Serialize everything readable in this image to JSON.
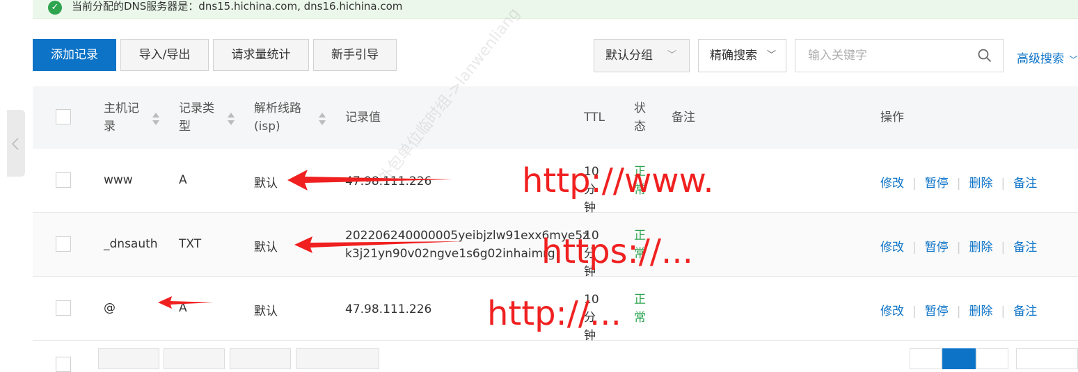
{
  "notice": {
    "text": "当前分配的DNS服务器是：dns15.hichina.com, dns16.hichina.com"
  },
  "toolbar": {
    "add_record": "添加记录",
    "import_export": "导入/导出",
    "request_stats": "请求量统计",
    "guide": "新手引导",
    "group_select": "默认分组",
    "search_mode": "精确搜索",
    "search_placeholder": "输入关键字",
    "advanced_search": "高级搜索"
  },
  "table": {
    "headers": {
      "host_line1": "主机记",
      "host_line2": "录",
      "type_line1": "记录类",
      "type_line2": "型",
      "line_line1": "解析线路",
      "line_line2": "(isp)",
      "value": "记录值",
      "ttl": "TTL",
      "status_line1": "状",
      "status_line2": "态",
      "remark": "备注",
      "actions": "操作"
    },
    "rows": [
      {
        "host": "www",
        "type": "A",
        "line": "默认",
        "value_line1": "47.98.111.226",
        "value_line2": "",
        "ttl_line1": "10 分",
        "ttl_line2": "钟",
        "status_line1": "正",
        "status_line2": "常"
      },
      {
        "host": "_dnsauth",
        "type": "TXT",
        "line": "默认",
        "value_line1": "202206240000005yeibjzlw91exx6mye5z",
        "value_line2": "k3j21yn90v02ngve1s6g02inhaimrg",
        "ttl_line1": "10 分",
        "ttl_line2": "钟",
        "status_line1": "正",
        "status_line2": "常"
      },
      {
        "host": "@",
        "type": "A",
        "line": "默认",
        "value_line1": "47.98.111.226",
        "value_line2": "",
        "ttl_line1": "10 分",
        "ttl_line2": "钟",
        "status_line1": "正",
        "status_line2": "常"
      }
    ],
    "actions": {
      "edit": "修改",
      "pause": "暂停",
      "delete": "删除",
      "remark": "备注"
    }
  },
  "annotations": {
    "a1": "http://www.",
    "a2": "https://...",
    "a3": "http://..."
  },
  "watermark": "外包单位临时组->lanwenliang",
  "colors": {
    "primary": "#0d73c7",
    "success": "#2ea44f",
    "annotation": "#f02020",
    "notice_bg": "#ebf7ea"
  }
}
